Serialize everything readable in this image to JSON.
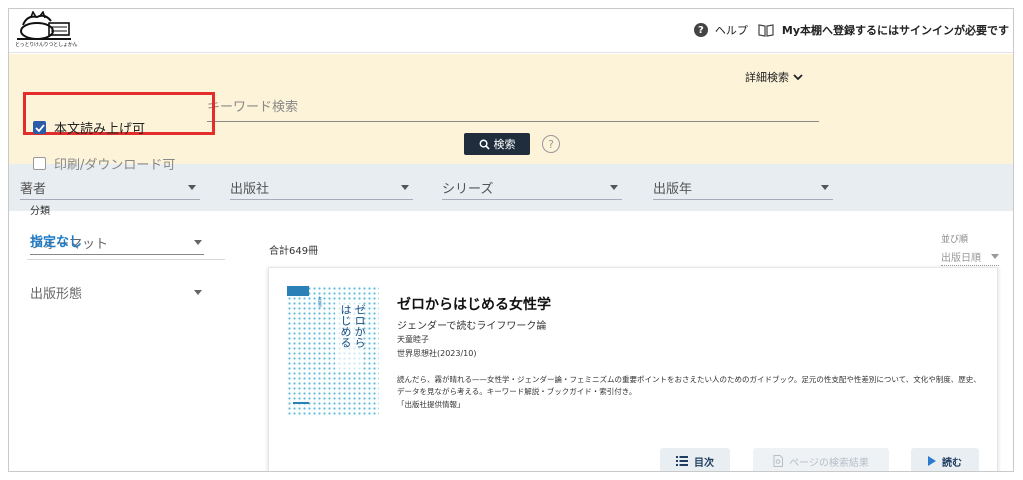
{
  "header": {
    "logo_caption": "とっとりけんりつとしょかん",
    "help_label": "ヘルプ",
    "signin_message": "My本棚へ登録するにはサインインが必要です"
  },
  "search": {
    "advanced_label": "詳細検索",
    "keyword_placeholder": "キーワード検索",
    "submit_label": "検索",
    "help_glyph": "?"
  },
  "filters": {
    "author": "著者",
    "publisher": "出版社",
    "series": "シリーズ",
    "year": "出版年"
  },
  "sidebar": {
    "format_label": "フォーマット",
    "publish_form_label": "出版形態",
    "readaloud_label": "本文読み上げ可",
    "readaloud_checked": true,
    "download_label": "印刷/ダウンロード可",
    "download_checked": false,
    "classification_heading": "分類",
    "classification_value": "指定なし"
  },
  "results": {
    "count_text": "合計649冊",
    "sort_heading": "並び順",
    "sort_value": "出版日順"
  },
  "book": {
    "title": "ゼロからはじめる女性学",
    "subtitle": "ジェンダーで読むライフワーク論",
    "author": "天童睦子",
    "publisher_date": "世界思想社(2023/10)",
    "description": "読んだら、霧が晴れる——女性学・ジェンダー論・フェミニズムの重要ポイントをおさえたい人のためのガイドブック。足元の性支配や性差別について、文化や制度、歴史、データを見ながら考える。キーワード解説・ブックガイド・索引付き。",
    "source": "「出版社提供情報」",
    "cover_title_1": "ゼロから",
    "cover_title_2": "はじめる",
    "cover_title_3": "女性学"
  },
  "actions": {
    "toc_label": "目次",
    "page_search_label": "ページの検索結果",
    "read_label": "読む"
  },
  "colors": {
    "search_panel_bg": "#fdf3d9",
    "filter_bar_bg": "#e8edf1",
    "primary_dark": "#1f2d3d",
    "highlight_red": "#e32d2d",
    "link_blue": "#1e7cc8",
    "checkbox_blue": "#2c5ba8"
  }
}
